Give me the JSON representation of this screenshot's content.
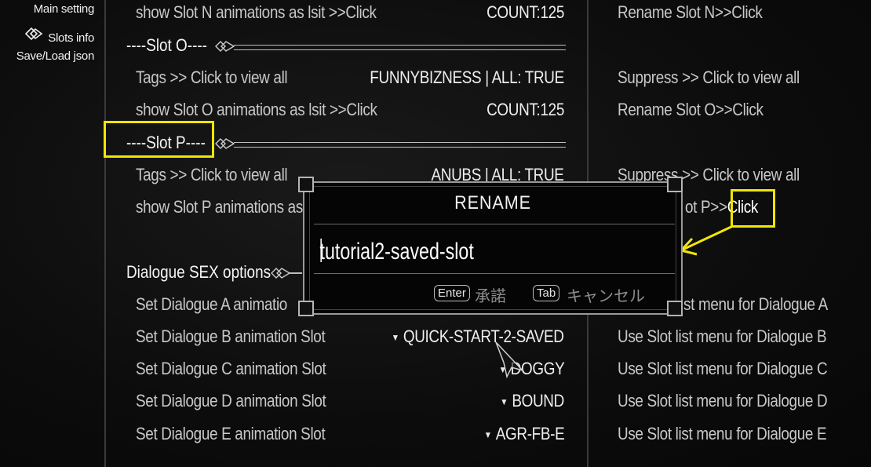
{
  "sidebar": {
    "items": [
      {
        "label": "Main setting",
        "icon": ""
      },
      {
        "label": "Slots info",
        "icon": "slots-diamond-icon"
      },
      {
        "label": "Save/Load json",
        "icon": ""
      }
    ]
  },
  "rows": {
    "slot_n_list": {
      "label": "show Slot N animations as lsit >>Click",
      "value": "COUNT:125",
      "col3": "Rename Slot N>>Click"
    },
    "slot_o_header": "----Slot O----",
    "slot_o_tags": {
      "label": "Tags >> Click to view all",
      "value": "FUNNYBIZNESS | ALL: TRUE",
      "col3": "Suppress >> Click to view all"
    },
    "slot_o_list": {
      "label": "show Slot O animations as lsit >>Click",
      "value": "COUNT:125",
      "col3": "Rename Slot O>>Click"
    },
    "slot_p_header": "----Slot P----",
    "slot_p_tags": {
      "label": "Tags >> Click to view all",
      "value": "ANUBS | ALL: TRUE",
      "col3": "Suppress >> Click to view all"
    },
    "slot_p_list": {
      "label": "show Slot P animations as",
      "col3_a": "ot P>>",
      "col3_b": "Click"
    },
    "dialogue_header": "Dialogue SEX options",
    "dialogue": [
      {
        "label": "Set Dialogue A animatio",
        "value": "",
        "col3": "st menu for Dialogue A"
      },
      {
        "label": "Set Dialogue B animation Slot",
        "value": "QUICK-START-2-SAVED",
        "col3": "Use Slot list menu for Dialogue B"
      },
      {
        "label": "Set Dialogue C animation Slot",
        "value": "DOGGY",
        "col3": "Use Slot list menu for Dialogue C"
      },
      {
        "label": "Set Dialogue D animation Slot",
        "value": "BOUND",
        "col3": "Use Slot list menu for Dialogue D"
      },
      {
        "label": "Set Dialogue E animation Slot",
        "value": "AGR-FB-E",
        "col3": "Use Slot list menu for Dialogue E"
      }
    ]
  },
  "dialog": {
    "title": "RENAME",
    "input_value": "tutorial2-saved-slot",
    "enter_key": "Enter",
    "accept_label": "承諾",
    "tab_key": "Tab",
    "cancel_label": "キャンセル"
  },
  "colors": {
    "highlight": "#f2e600",
    "background": "#0c0c0c"
  }
}
